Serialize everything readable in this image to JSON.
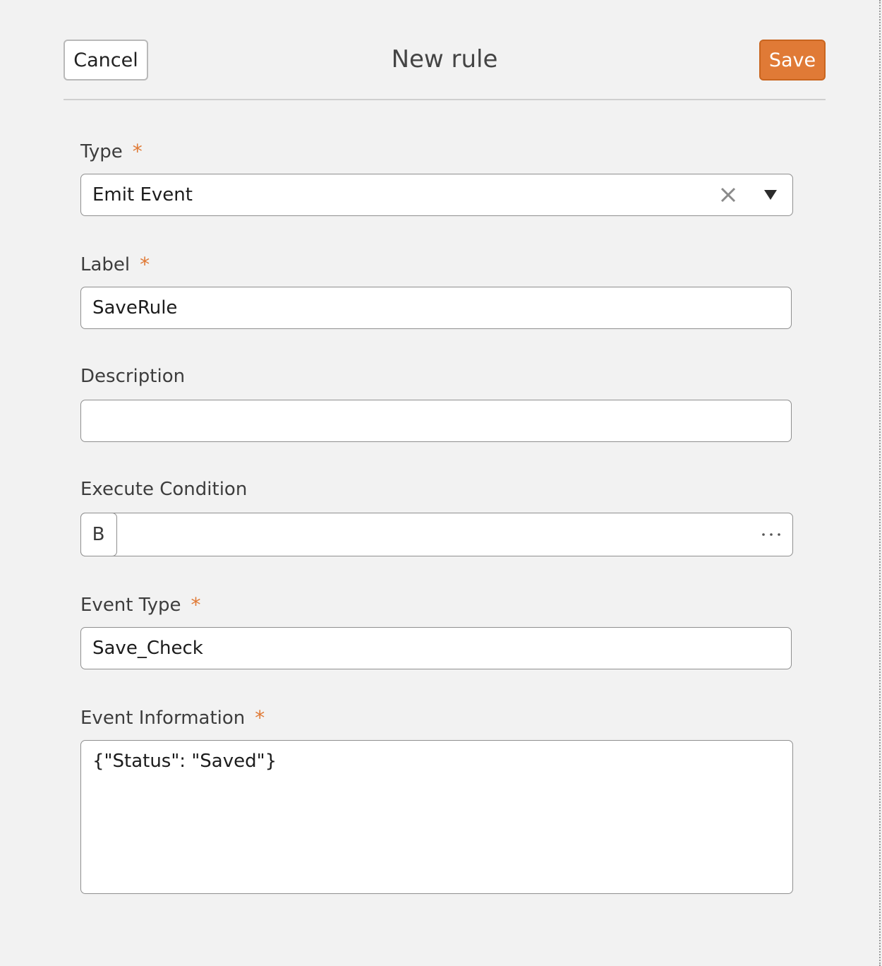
{
  "header": {
    "cancel_label": "Cancel",
    "title": "New rule",
    "save_label": "Save"
  },
  "colors": {
    "accent": "#e07a36",
    "background": "#f2f2f2"
  },
  "form": {
    "required_marker": "*",
    "type": {
      "label": "Type",
      "value": "Emit Event",
      "clear_icon": "close-icon",
      "dropdown_icon": "caret-down-icon"
    },
    "label": {
      "label": "Label",
      "value": "SaveRule"
    },
    "description": {
      "label": "Description",
      "value": ""
    },
    "execute_condition": {
      "label": "Execute Condition",
      "chip": "B",
      "value": "",
      "more_icon": "ellipsis-icon"
    },
    "event_type": {
      "label": "Event Type",
      "value": "Save_Check"
    },
    "event_information": {
      "label": "Event Information",
      "value": "{\"Status\": \"Saved\"}"
    }
  }
}
